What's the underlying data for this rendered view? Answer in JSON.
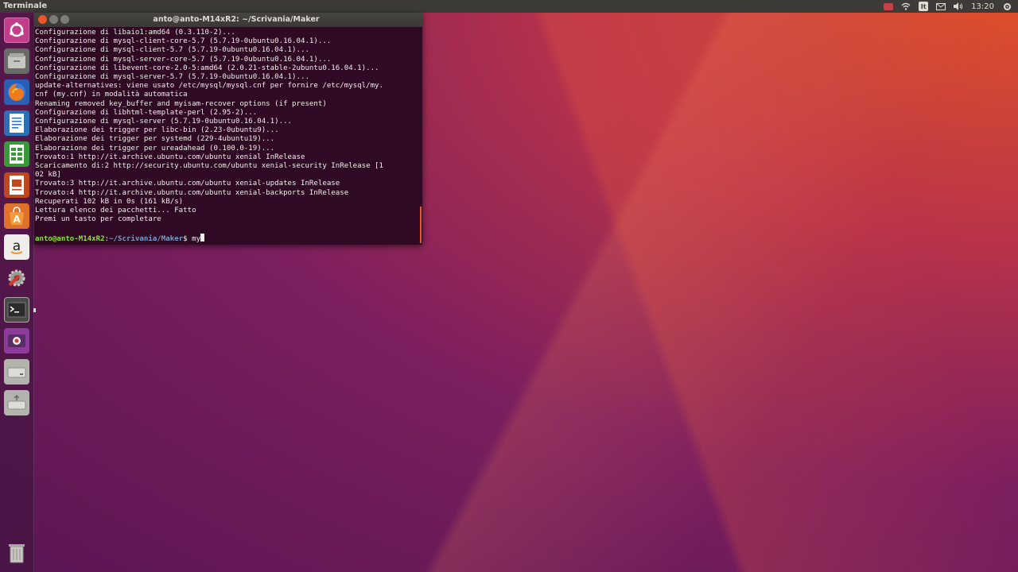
{
  "top_panel": {
    "app_title": "Terminale",
    "lang": "It",
    "clock": "13:20"
  },
  "launcher": {
    "items": [
      {
        "name": "dash-icon"
      },
      {
        "name": "files-icon"
      },
      {
        "name": "firefox-icon"
      },
      {
        "name": "writer-icon"
      },
      {
        "name": "calc-icon"
      },
      {
        "name": "impress-icon"
      },
      {
        "name": "software-center-icon"
      },
      {
        "name": "amazon-icon"
      },
      {
        "name": "system-settings-icon"
      },
      {
        "name": "terminal-icon"
      },
      {
        "name": "screen-recorder-icon"
      },
      {
        "name": "drive-icon"
      },
      {
        "name": "usb-drive-icon"
      },
      {
        "name": "trash-icon"
      }
    ]
  },
  "terminal": {
    "title": "anto@anto-M14xR2: ~/Scrivania/Maker",
    "lines": [
      "Configurazione di libaio1:amd64 (0.3.110-2)...",
      "Configurazione di mysql-client-core-5.7 (5.7.19-0ubuntu0.16.04.1)...",
      "Configurazione di mysql-client-5.7 (5.7.19-0ubuntu0.16.04.1)...",
      "Configurazione di mysql-server-core-5.7 (5.7.19-0ubuntu0.16.04.1)...",
      "Configurazione di libevent-core-2.0-5:amd64 (2.0.21-stable-2ubuntu0.16.04.1)...",
      "Configurazione di mysql-server-5.7 (5.7.19-0ubuntu0.16.04.1)...",
      "update-alternatives: viene usato /etc/mysql/mysql.cnf per fornire /etc/mysql/my.",
      "cnf (my.cnf) in modalità automatica",
      "Renaming removed key_buffer and myisam-recover options (if present)",
      "Configurazione di libhtml-template-perl (2.95-2)...",
      "Configurazione di mysql-server (5.7.19-0ubuntu0.16.04.1)...",
      "Elaborazione dei trigger per libc-bin (2.23-0ubuntu9)...",
      "Elaborazione dei trigger per systemd (229-4ubuntu19)...",
      "Elaborazione dei trigger per ureadahead (0.100.0-19)...",
      "Trovato:1 http://it.archive.ubuntu.com/ubuntu xenial InRelease",
      "Scaricamento di:2 http://security.ubuntu.com/ubuntu xenial-security InRelease [1",
      "02 kB]",
      "Trovato:3 http://it.archive.ubuntu.com/ubuntu xenial-updates InRelease",
      "Trovato:4 http://it.archive.ubuntu.com/ubuntu xenial-backports InRelease",
      "Recuperati 102 kB in 0s (161 kB/s)",
      "Lettura elenco dei pacchetti... Fatto",
      "Premi un tasto per completare",
      ""
    ],
    "prompt_user": "anto@anto-M14xR2",
    "prompt_sep": ":",
    "prompt_path": "~/Scrivania/Maker",
    "prompt_symbol": "$ ",
    "input": "my"
  },
  "colors": {
    "terminal_bg": "#300a24",
    "prompt_green": "#8ae234",
    "prompt_blue": "#729fcf",
    "close_orange": "#e4582e"
  }
}
